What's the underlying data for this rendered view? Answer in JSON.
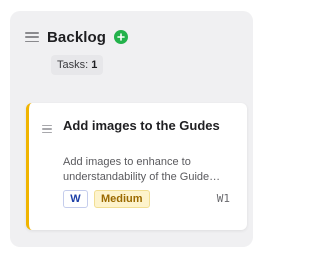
{
  "column": {
    "title": "Backlog",
    "add_icon": "plus-icon",
    "accent_add_color": "#23b24b",
    "task_count_label": "Tasks:",
    "task_count_value": "1"
  },
  "cards": [
    {
      "title": "Add images to the Gudes",
      "description": "Add images to enhance to understandability of the Guide…",
      "tags": [
        {
          "label": "W",
          "color": "#1c3fa8"
        },
        {
          "label": "Medium",
          "color": "#9b6a00"
        }
      ],
      "id": "W1",
      "accent_color": "#f0b400"
    }
  ]
}
